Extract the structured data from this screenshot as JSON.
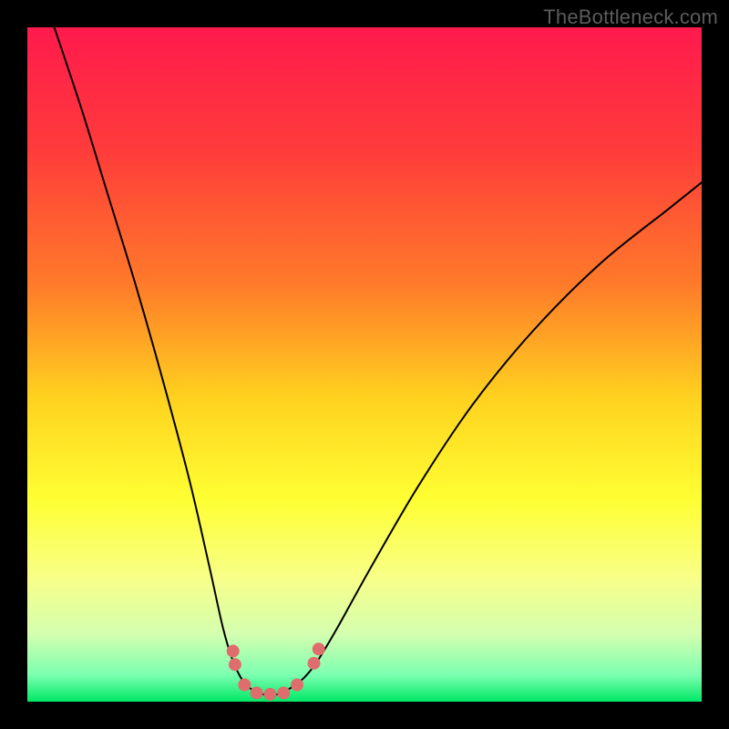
{
  "watermark": "TheBottleneck.com",
  "chart_data": {
    "type": "line",
    "title": "",
    "xlabel": "",
    "ylabel": "",
    "xlim": [
      0,
      100
    ],
    "ylim": [
      0,
      100
    ],
    "grid": false,
    "legend": false,
    "background_gradient_stops": [
      {
        "offset": 0.0,
        "color": "#ff1a4d"
      },
      {
        "offset": 0.18,
        "color": "#ff3b3b"
      },
      {
        "offset": 0.38,
        "color": "#ff7a2a"
      },
      {
        "offset": 0.55,
        "color": "#ffd21f"
      },
      {
        "offset": 0.7,
        "color": "#ffff33"
      },
      {
        "offset": 0.82,
        "color": "#f7ff8a"
      },
      {
        "offset": 0.9,
        "color": "#d4ffb0"
      },
      {
        "offset": 0.96,
        "color": "#7dffb0"
      },
      {
        "offset": 1.0,
        "color": "#00e866"
      }
    ],
    "series": [
      {
        "name": "bottleneck-curve-left",
        "color": "#000000",
        "width": 2,
        "x": [
          4,
          8,
          12,
          16,
          20,
          24,
          27,
          29,
          30.5,
          32,
          33
        ],
        "y": [
          100,
          88,
          75,
          62,
          48,
          33,
          20,
          11,
          6,
          3,
          2
        ]
      },
      {
        "name": "bottleneck-curve-right",
        "color": "#000000",
        "width": 2,
        "x": [
          39,
          41,
          43,
          46,
          51,
          58,
          66,
          75,
          85,
          95,
          100
        ],
        "y": [
          2,
          3.5,
          6,
          11,
          20,
          32,
          44,
          55,
          65,
          73,
          77
        ]
      },
      {
        "name": "bottleneck-flat-bottom",
        "color": "#000000",
        "width": 2,
        "x": [
          33,
          34.5,
          36,
          37.5,
          39
        ],
        "y": [
          2,
          1.2,
          1,
          1.2,
          2
        ]
      }
    ],
    "markers": {
      "name": "highlight-dots",
      "color": "#e06d6d",
      "radius": 7,
      "points": [
        {
          "x": 30.5,
          "y": 7.5
        },
        {
          "x": 30.8,
          "y": 5.5
        },
        {
          "x": 32.2,
          "y": 2.5
        },
        {
          "x": 34.0,
          "y": 1.3
        },
        {
          "x": 36.0,
          "y": 1.1
        },
        {
          "x": 38.0,
          "y": 1.3
        },
        {
          "x": 40.0,
          "y": 2.5
        },
        {
          "x": 42.5,
          "y": 5.7
        },
        {
          "x": 43.2,
          "y": 7.8
        }
      ]
    }
  }
}
